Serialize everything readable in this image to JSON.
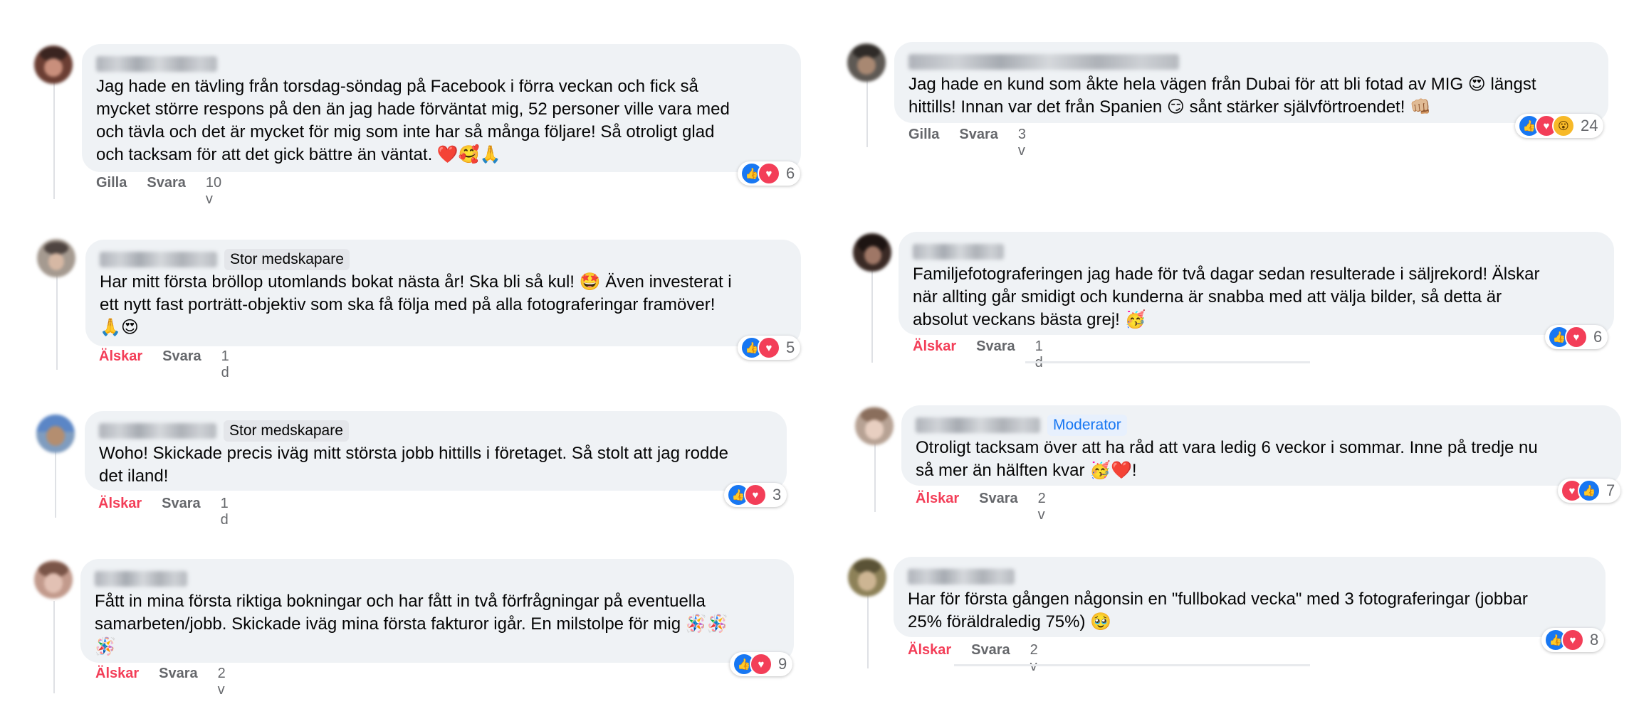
{
  "reaction_colors": {
    "like": "#1877f2",
    "love": "#f33e58",
    "wow": "#f7b928",
    "liked_text": "#f33e58"
  },
  "icons": {
    "like": "thumbs-up-icon",
    "love": "heart-icon",
    "wow": "wow-face-icon"
  },
  "comments": [
    {
      "badge": "",
      "text": "Jag hade en tävling från torsdag-söndag på Facebook i förra veckan och fick så\nmycket större respons på den än jag hade förväntat mig, 52 personer ville vara med\noch tävla och det är mycket för mig som inte har så många följare! Så otroligt glad\noch tacksam för att det gick bättre än väntat. ❤️🥰🙏",
      "action": "Gilla",
      "reply": "Svara",
      "time": "10 v",
      "reaction_count": "6",
      "reactions": [
        "like",
        "love"
      ]
    },
    {
      "badge": "Stor medskapare",
      "text": "Har mitt första bröllop utomlands bokat nästa år! Ska bli så kul! 🤩 Även investerat i\nett nytt fast porträtt-objektiv som ska få följa med på alla fotograferingar framöver!\n🙏😍",
      "action": "Älskar",
      "reply": "Svara",
      "time": "1 d",
      "reaction_count": "5",
      "reactions": [
        "like",
        "love"
      ]
    },
    {
      "badge": "Stor medskapare",
      "text": "Woho! Skickade precis iväg mitt största jobb hittills i företaget. Så stolt att jag rodde\ndet iland!",
      "action": "Älskar",
      "reply": "Svara",
      "time": "1 d",
      "reaction_count": "3",
      "reactions": [
        "like",
        "love"
      ]
    },
    {
      "badge": "",
      "text": "Fått in mina första riktiga bokningar och har fått in två förfrågningar på eventuella\nsamarbeten/jobb. Skickade iväg mina första fakturor igår. En milstolpe för mig 🪅🪅\n🪅",
      "action": "Älskar",
      "reply": "Svara",
      "time": "2 v",
      "reaction_count": "9",
      "reactions": [
        "like",
        "love"
      ]
    },
    {
      "badge": "",
      "text": "Jag hade en kund som åkte hela vägen från Dubai för att bli fotad av MIG 😍 längst\nhittills! Innan var det från Spanien 😏 sånt stärker självförtroendet! 👊🏼",
      "action": "Gilla",
      "reply": "Svara",
      "time": "3 v",
      "reaction_count": "24",
      "reactions": [
        "like",
        "love",
        "wow"
      ]
    },
    {
      "badge": "",
      "text": "Familjefotograferingen jag hade för två dagar sedan resulterade i säljrekord! Älskar\nnär allting går smidigt och kunderna är snabba med att välja bilder, så detta är\nabsolut veckans bästa grej! 🥳",
      "action": "Älskar",
      "reply": "Svara",
      "time": "1 d",
      "reaction_count": "6",
      "reactions": [
        "like",
        "love"
      ]
    },
    {
      "badge": "Moderator",
      "text": "Otroligt tacksam över att ha råd att vara ledig 6 veckor i sommar. Inne på tredje nu\nså mer än hälften kvar 🥳❤️!",
      "action": "Älskar",
      "reply": "Svara",
      "time": "2 v",
      "reaction_count": "7",
      "reactions": [
        "love",
        "like"
      ]
    },
    {
      "badge": "",
      "text": "Har för första gången någonsin en \"fullbokad vecka\" med 3 fotograferingar (jobbar\n25% föräldraledig 75%) 🥹",
      "action": "Älskar",
      "reply": "Svara",
      "time": "2 v",
      "reaction_count": "8",
      "reactions": [
        "like",
        "love"
      ]
    }
  ]
}
